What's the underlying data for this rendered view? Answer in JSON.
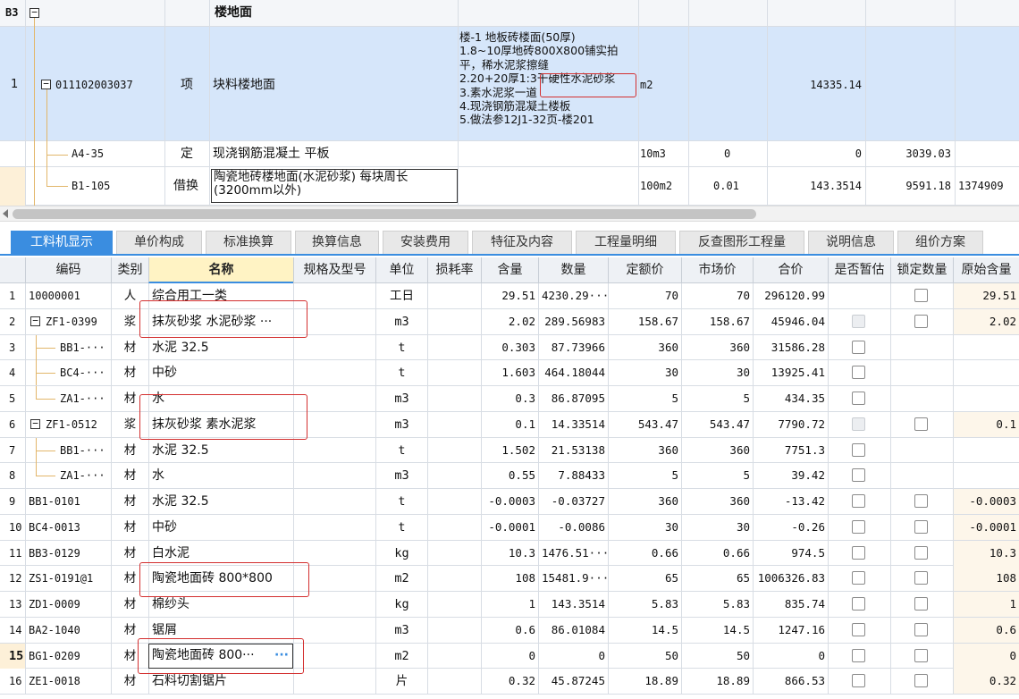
{
  "upper": {
    "header_row": {
      "id": "B3",
      "name": "楼地面"
    },
    "item_row": {
      "index": "1",
      "code": "011102003037",
      "type": "项",
      "name": "块料楼地面",
      "description_lines": [
        "楼-1 地板砖楼面(50厚)",
        "1.8~10厚地砖800X800铺实拍",
        "平，稀水泥浆擦缝",
        "2.20+20厚1:3干硬性水泥砂浆",
        "3.素水泥浆一道",
        "4.现浇钢筋混凝土楼板",
        "5.做法参12J1-32页-楼201"
      ],
      "unit": "m2",
      "quantity": "14335.14"
    },
    "sub_rows": [
      {
        "code": "A4-35",
        "type": "定",
        "name": "现浇钢筋混凝土 平板",
        "unit": "10m3",
        "c1": "0",
        "c2": "0",
        "c3": "3039.03",
        "c4": ""
      },
      {
        "code": "B1-105",
        "type": "借换",
        "name": "陶瓷地砖楼地面(水泥砂浆) 每块周长(3200mm以外)",
        "unit": "100m2",
        "c1": "0.01",
        "c2": "143.3514",
        "c3": "9591.18",
        "c4": "1374909"
      }
    ]
  },
  "tabs": [
    {
      "label": "工料机显示",
      "active": true
    },
    {
      "label": "单价构成"
    },
    {
      "label": "标准换算"
    },
    {
      "label": "换算信息"
    },
    {
      "label": "安装费用"
    },
    {
      "label": "特征及内容"
    },
    {
      "label": "工程量明细"
    },
    {
      "label": "反查图形工程量"
    },
    {
      "label": "说明信息"
    },
    {
      "label": "组价方案"
    }
  ],
  "table": {
    "columns": [
      "编码",
      "类别",
      "名称",
      "规格及型号",
      "单位",
      "损耗率",
      "含量",
      "数量",
      "定额价",
      "市场价",
      "合价",
      "是否暂估",
      "锁定数量",
      "原始含量"
    ],
    "rows": [
      {
        "idx": "1",
        "code": "10000001",
        "cat": "人",
        "name": "综合用工一类",
        "unit": "工日",
        "content": "29.51",
        "qty": "4230.29···",
        "quota": "70",
        "market": "70",
        "total": "296120.99",
        "est": "",
        "lock": "cb",
        "orig": "29.51"
      },
      {
        "idx": "2",
        "code": "ZF1-0399",
        "cat": "浆",
        "name": "抹灰砂浆 水泥砂浆 ···",
        "unit": "m3",
        "content": "2.02",
        "qty": "289.56983",
        "quota": "158.67",
        "market": "158.67",
        "total": "45946.04",
        "est": "dis",
        "lock": "cb",
        "orig": "2.02",
        "parent": true
      },
      {
        "idx": "3",
        "code": "BB1-···",
        "cat": "材",
        "name": "水泥 32.5",
        "unit": "t",
        "content": "0.303",
        "qty": "87.73966",
        "quota": "360",
        "market": "360",
        "total": "31586.28",
        "est": "cb",
        "lock": "",
        "orig": "",
        "child": true
      },
      {
        "idx": "4",
        "code": "BC4-···",
        "cat": "材",
        "name": "中砂",
        "unit": "t",
        "content": "1.603",
        "qty": "464.18044",
        "quota": "30",
        "market": "30",
        "total": "13925.41",
        "est": "cb",
        "lock": "",
        "orig": "",
        "child": true
      },
      {
        "idx": "5",
        "code": "ZA1-···",
        "cat": "材",
        "name": "水",
        "unit": "m3",
        "content": "0.3",
        "qty": "86.87095",
        "quota": "5",
        "market": "5",
        "total": "434.35",
        "est": "cb",
        "lock": "",
        "orig": "",
        "child": true,
        "last": true
      },
      {
        "idx": "6",
        "code": "ZF1-0512",
        "cat": "浆",
        "name": "抹灰砂浆 素水泥浆",
        "unit": "m3",
        "content": "0.1",
        "qty": "14.33514",
        "quota": "543.47",
        "market": "543.47",
        "total": "7790.72",
        "est": "dis",
        "lock": "cb",
        "orig": "0.1",
        "parent": true
      },
      {
        "idx": "7",
        "code": "BB1-···",
        "cat": "材",
        "name": "水泥 32.5",
        "unit": "t",
        "content": "1.502",
        "qty": "21.53138",
        "quota": "360",
        "market": "360",
        "total": "7751.3",
        "est": "cb",
        "lock": "",
        "orig": "",
        "child": true
      },
      {
        "idx": "8",
        "code": "ZA1-···",
        "cat": "材",
        "name": "水",
        "unit": "m3",
        "content": "0.55",
        "qty": "7.88433",
        "quota": "5",
        "market": "5",
        "total": "39.42",
        "est": "cb",
        "lock": "",
        "orig": "",
        "child": true,
        "last": true
      },
      {
        "idx": "9",
        "code": "BB1-0101",
        "cat": "材",
        "name": "水泥 32.5",
        "unit": "t",
        "content": "-0.0003",
        "qty": "-0.03727",
        "quota": "360",
        "market": "360",
        "total": "-13.42",
        "est": "cb",
        "lock": "cb",
        "orig": "-0.0003"
      },
      {
        "idx": "10",
        "code": "BC4-0013",
        "cat": "材",
        "name": "中砂",
        "unit": "t",
        "content": "-0.0001",
        "qty": "-0.0086",
        "quota": "30",
        "market": "30",
        "total": "-0.26",
        "est": "cb",
        "lock": "cb",
        "orig": "-0.0001"
      },
      {
        "idx": "11",
        "code": "BB3-0129",
        "cat": "材",
        "name": "白水泥",
        "unit": "kg",
        "content": "10.3",
        "qty": "1476.51···",
        "quota": "0.66",
        "market": "0.66",
        "total": "974.5",
        "est": "cb",
        "lock": "cb",
        "orig": "10.3"
      },
      {
        "idx": "12",
        "code": "ZS1-0191@1",
        "cat": "材",
        "name": "陶瓷地面砖 800*800",
        "unit": "m2",
        "content": "108",
        "qty": "15481.9···",
        "quota": "65",
        "market": "65",
        "total": "1006326.83",
        "est": "cb",
        "lock": "cb",
        "orig": "108"
      },
      {
        "idx": "13",
        "code": "ZD1-0009",
        "cat": "材",
        "name": "棉纱头",
        "unit": "kg",
        "content": "1",
        "qty": "143.3514",
        "quota": "5.83",
        "market": "5.83",
        "total": "835.74",
        "est": "cb",
        "lock": "cb",
        "orig": "1"
      },
      {
        "idx": "14",
        "code": "BA2-1040",
        "cat": "材",
        "name": "锯屑",
        "unit": "m3",
        "content": "0.6",
        "qty": "86.01084",
        "quota": "14.5",
        "market": "14.5",
        "total": "1247.16",
        "est": "cb",
        "lock": "cb",
        "orig": "0.6"
      },
      {
        "idx": "15",
        "code": "BG1-0209",
        "cat": "材",
        "name": "陶瓷地面砖 800···",
        "unit": "m2",
        "content": "0",
        "qty": "0",
        "quota": "50",
        "market": "50",
        "total": "0",
        "est": "cb",
        "lock": "cb",
        "orig": "0",
        "editing": true
      },
      {
        "idx": "16",
        "code": "ZE1-0018",
        "cat": "材",
        "name": "石料切割锯片",
        "unit": "片",
        "content": "0.32",
        "qty": "45.87245",
        "quota": "18.89",
        "market": "18.89",
        "total": "866.53",
        "est": "cb",
        "lock": "cb",
        "orig": "0.32"
      }
    ],
    "ellipsis_button": "···"
  },
  "colors": {
    "highlight_row": "#d6e6fa",
    "tab_active": "#3a8de0",
    "annotation": "#d32f2f",
    "cream": "#fdf6ea"
  }
}
